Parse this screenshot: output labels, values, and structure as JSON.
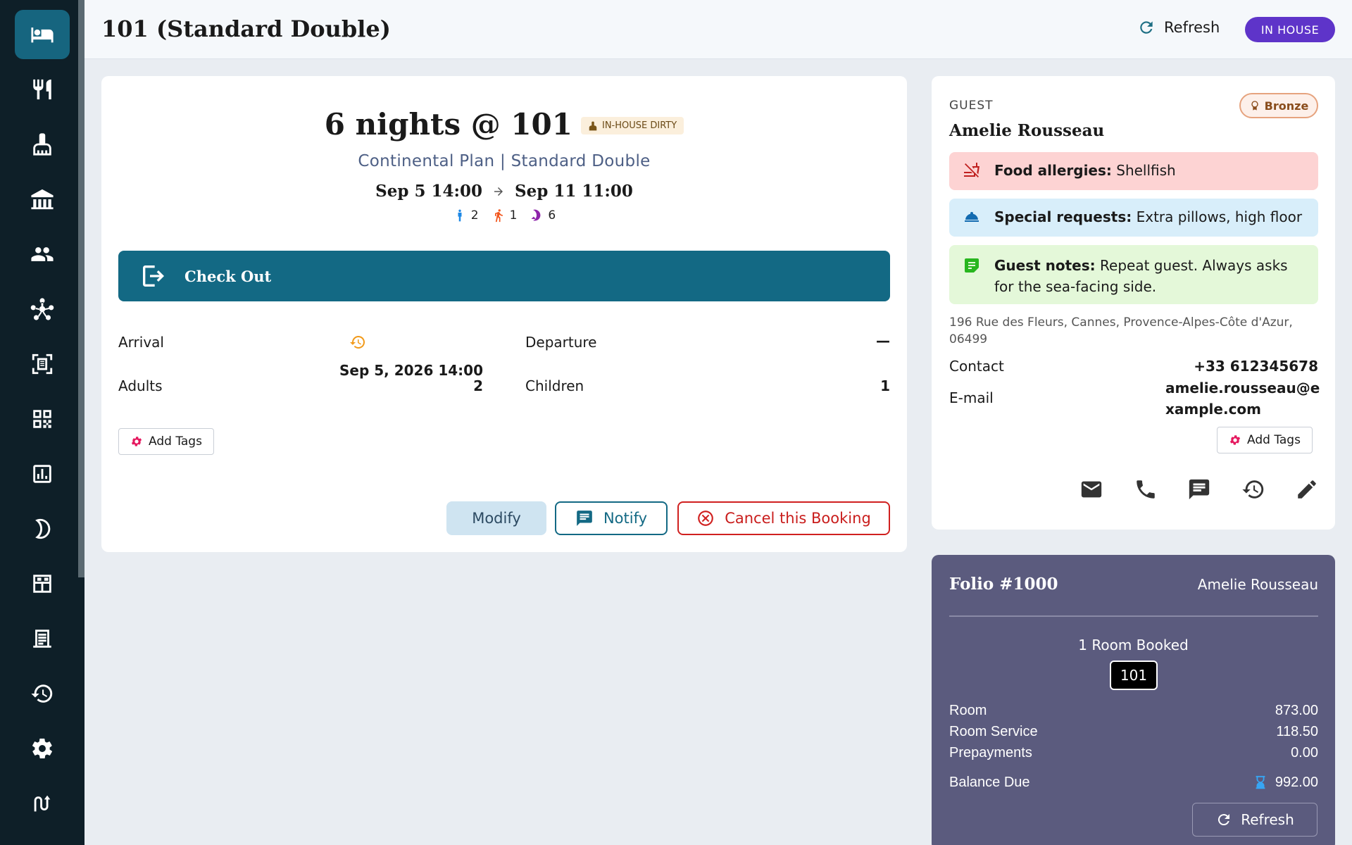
{
  "header": {
    "title": "101 (Standard Double)",
    "refresh_label": "Refresh",
    "status": "IN HOUSE"
  },
  "sidebar": {
    "items": [
      {
        "icon": "bed-icon",
        "active": true
      },
      {
        "icon": "restaurant-icon"
      },
      {
        "icon": "housekeeping-icon"
      },
      {
        "icon": "property-icon"
      },
      {
        "icon": "guests-icon"
      },
      {
        "icon": "hub-icon"
      },
      {
        "icon": "scanner-icon"
      },
      {
        "icon": "qr-code-icon"
      },
      {
        "icon": "reports-icon"
      },
      {
        "icon": "night-audit-icon"
      },
      {
        "icon": "room-grid-icon"
      },
      {
        "icon": "invoice-icon"
      },
      {
        "icon": "history-icon"
      },
      {
        "icon": "settings-icon"
      },
      {
        "icon": "logo-icon"
      }
    ]
  },
  "booking": {
    "nights_title": "6 nights @ 101",
    "housekeeping_status": "IN-HOUSE DIRTY",
    "plan_line": "Continental Plan | Standard Double",
    "start": "Sep 5 14:00",
    "end": "Sep 11 11:00",
    "occupancy": {
      "adults": "2",
      "children": "1",
      "nights": "6"
    },
    "checkout_label": "Check Out",
    "fields": {
      "arrival_label": "Arrival",
      "arrival_value": "Sep 5, 2026 14:00",
      "departure_label": "Departure",
      "departure_value": "—",
      "adults_label": "Adults",
      "adults_value": "2",
      "children_label": "Children",
      "children_value": "1"
    },
    "add_tags_label": "Add Tags",
    "actions": {
      "modify": "Modify",
      "notify": "Notify",
      "cancel": "Cancel this Booking"
    }
  },
  "guest": {
    "caption": "GUEST",
    "name": "Amelie Rousseau",
    "tier": "Bronze",
    "food_allergies_label": "Food allergies:",
    "food_allergies_value": "Shellfish",
    "special_requests_label": "Special requests:",
    "special_requests_value": "Extra pillows, high floor",
    "notes_label": "Guest notes:",
    "notes_value": "Repeat guest. Always asks for the sea-facing side.",
    "address": "196 Rue des Fleurs, Cannes, Provence-Alpes-Côte d'Azur, 06499",
    "contact_label": "Contact",
    "contact_value": "+33 612345678",
    "email_label": "E-mail",
    "email_value": "amelie.rousseau@example.com",
    "add_tags_label": "Add Tags",
    "action_icons": [
      "email-icon",
      "phone-icon",
      "message-icon",
      "history-icon",
      "edit-icon"
    ]
  },
  "folio": {
    "title": "Folio #1000",
    "owner": "Amelie Rousseau",
    "rooms_booked": "1 Room Booked",
    "room_number": "101",
    "lines": [
      {
        "label": "Room",
        "value": "873.00"
      },
      {
        "label": "Room Service",
        "value": "118.50"
      },
      {
        "label": "Prepayments",
        "value": "0.00"
      }
    ],
    "balance_label": "Balance Due",
    "balance_value": "992.00",
    "refresh_label": "Refresh"
  },
  "colors": {
    "sidebar_bg": "#0e1f28",
    "accent": "#136984",
    "status_pill": "#5e34c9",
    "folio_bg": "#5b5b7e",
    "danger": "#d0201f"
  }
}
